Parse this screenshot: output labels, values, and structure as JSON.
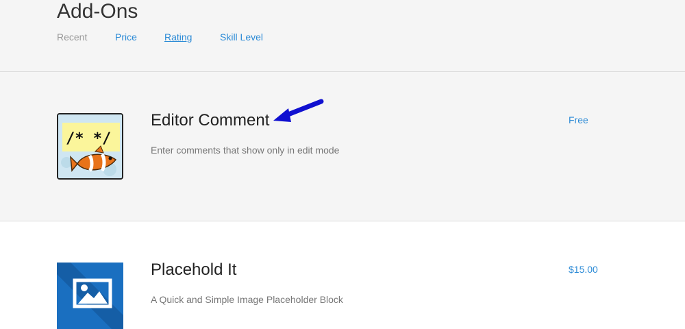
{
  "header": {
    "title": "Add-Ons",
    "tabs": [
      {
        "label": "Recent"
      },
      {
        "label": "Price"
      },
      {
        "label": "Rating"
      },
      {
        "label": "Skill Level"
      }
    ]
  },
  "addons": [
    {
      "name": "Editor Comment",
      "description": "Enter comments that show only in edit mode",
      "price": "Free",
      "icon": "clownfish-comment-icon",
      "icon_text": "/* */"
    },
    {
      "name": "Placehold It",
      "description": "A Quick and Simple Image Placeholder Block",
      "price": "$15.00",
      "icon": "image-placeholder-icon"
    }
  ],
  "colors": {
    "link": "#2b8ad6",
    "muted_tab": "#999999",
    "annotation_arrow": "#1010d0",
    "placeholder_tile": "#1a6fc0"
  }
}
